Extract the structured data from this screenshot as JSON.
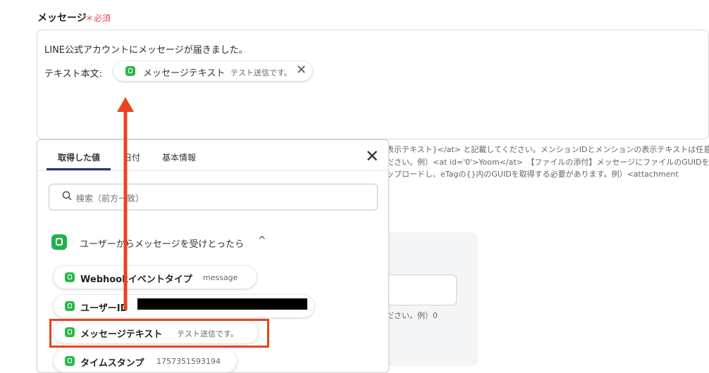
{
  "field": {
    "label": "メッセージ",
    "required_mark": "＊",
    "required_text": "必須"
  },
  "editor": {
    "line1": "LINE公式アカウントにメッセージが届きました。",
    "prefix": "テキスト本文:",
    "chip": {
      "label": "メッセージテキスト",
      "value": "テスト送信です。",
      "close": "✕"
    }
  },
  "help": {
    "lines": [
      "表示テキスト}</at> と記載してください。メンションIDとメンションの表示テキストは任意の",
      "ださい。例）<at id='0'>Yoom</at>　【ファイルの添付】メッセージにファイルのGUIDを",
      "ップロードし、eTagの{}内のGUIDを取得する必要があります。例）<attachment"
    ],
    "bottom": "ださい。例）0"
  },
  "panel": {
    "tabs": [
      "取得した値",
      "日付",
      "基本情報"
    ],
    "active_tab": 0,
    "close": "✕",
    "search_placeholder": "検索（前方一致）",
    "section_title": "ユーザーからメッセージを受けとったら",
    "section_chevron": "^",
    "items": [
      {
        "label": "Webhookイベントタイプ",
        "value": "message"
      },
      {
        "label": "ユーザーID",
        "value": ""
      },
      {
        "label": "メッセージテキスト",
        "value": "テスト送信です。"
      },
      {
        "label": "タイムスタンプ",
        "value": "1757351593194"
      }
    ]
  },
  "colors": {
    "line_green": "#1fb34a",
    "annotation_orange": "#e8441f",
    "required_red": "#e8464b",
    "tab_underline": "#1e3a68"
  }
}
